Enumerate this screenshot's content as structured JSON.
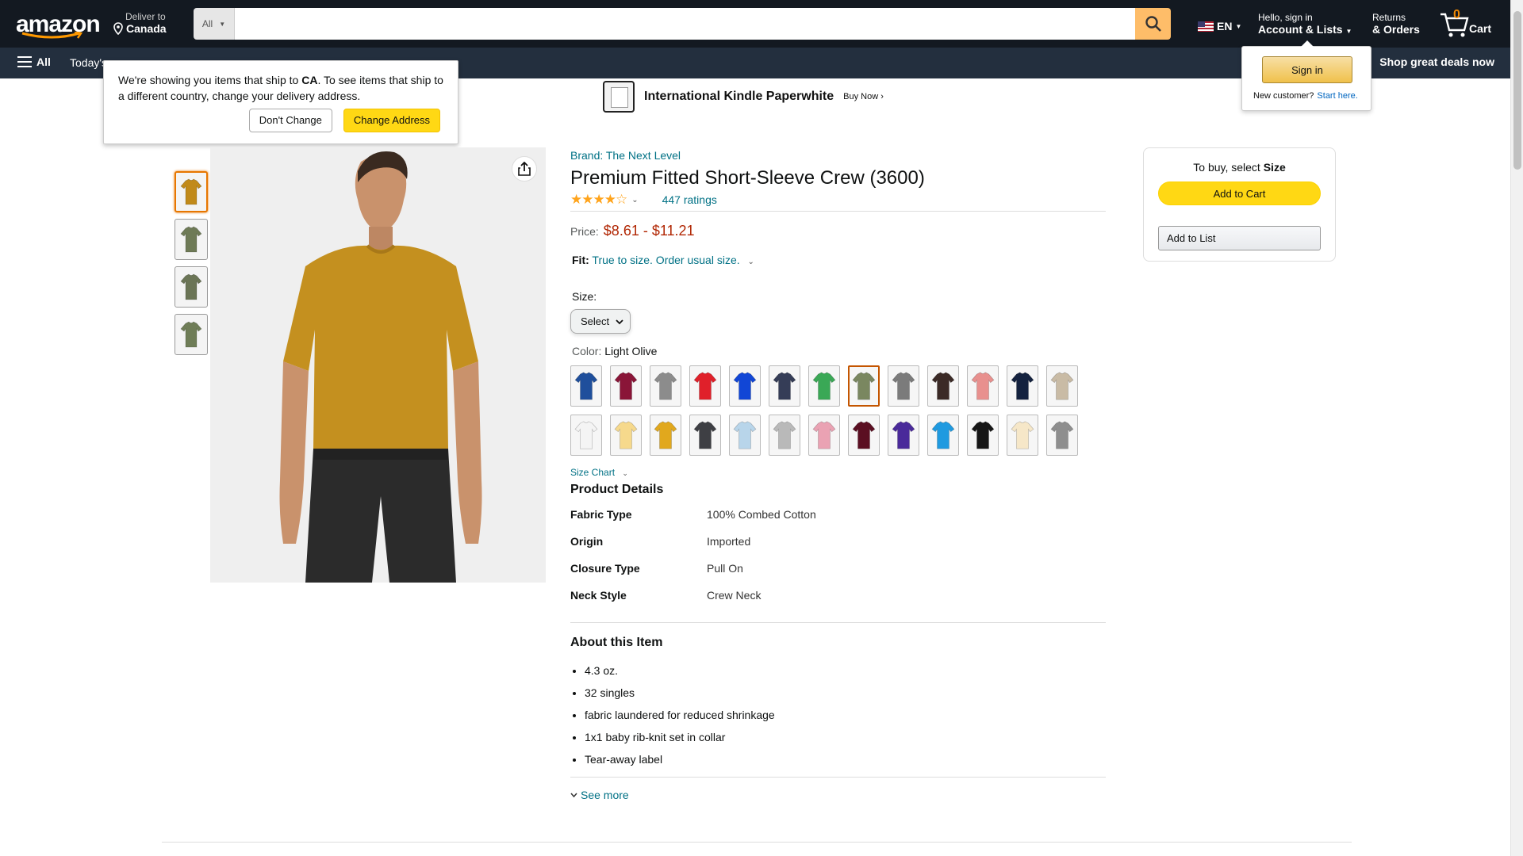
{
  "header": {
    "logo_text": "amazon",
    "deliver_line1": "Deliver to",
    "deliver_line2": "Canada",
    "search_category": "All",
    "search_placeholder": "",
    "lang": "EN",
    "account_line1": "Hello, sign in",
    "account_line2": "Account & Lists",
    "returns_line1": "Returns",
    "returns_line2": "& Orders",
    "cart_count": "0",
    "cart_label": "Cart"
  },
  "subnav": {
    "all_label": "All",
    "todays": "Today's",
    "deals": "Shop great deals now"
  },
  "banner": {
    "title": "International Kindle Paperwhite",
    "cta": "Buy Now ›"
  },
  "ship_popover": {
    "text_before": "We're showing you items that ship to ",
    "country": "CA",
    "text_after": ". To see items that ship to a different country, change your delivery address.",
    "dont_change": "Don't Change",
    "change_address": "Change Address"
  },
  "signin_popover": {
    "signin": "Sign in",
    "new_customer": "New customer?",
    "start_here": "Start here."
  },
  "product": {
    "brand": "Brand: The Next Level",
    "title": "Premium Fitted Short-Sleeve Crew (3600)",
    "stars": "★★★★☆",
    "ratings": "447 ratings",
    "price_label": "Price:",
    "price_range": "$8.61 - $11.21",
    "fit_label": "Fit:",
    "fit_value": "True to size. Order usual size.",
    "size_label": "Size:",
    "size_select": "Select",
    "color_label": "Color:",
    "color_value": "Light Olive",
    "size_chart": "Size Chart",
    "details_title": "Product Details",
    "details": [
      {
        "key": "Fabric Type",
        "value": "100% Combed Cotton"
      },
      {
        "key": "Origin",
        "value": "Imported"
      },
      {
        "key": "Closure Type",
        "value": "Pull On"
      },
      {
        "key": "Neck Style",
        "value": "Crew Neck"
      }
    ],
    "about_title": "About this Item",
    "about": [
      "4.3 oz.",
      "32 singles",
      "fabric laundered for reduced shrinkage",
      "1x1 baby rib-knit set in collar",
      "Tear-away label"
    ],
    "see_more": "See more"
  },
  "swatch_colors": [
    "#1f4f9c",
    "#8a1538",
    "#8c8c8c",
    "#e0202a",
    "#1146d6",
    "#353d57",
    "#3aa856",
    "#7a8760",
    "#7b7b7b",
    "#3b2a26",
    "#e8908e",
    "#14223f",
    "#c9bba5",
    "#f4f4f4",
    "#f6d98c",
    "#e1a81d",
    "#3e3f44",
    "#b8d5ea",
    "#b9b9b9",
    "#eaa2b3",
    "#5b0f22",
    "#4a2a9a",
    "#1f9ae0",
    "#161616",
    "#f6e7c8",
    "#8e8e8e"
  ],
  "thumb_colors": [
    "#c18a1a",
    "#6e7a56",
    "#6b7556",
    "#6f7d57"
  ],
  "buybox": {
    "need_prefix": "To buy, select ",
    "need_bold": "Size",
    "add_to_cart": "Add to Cart",
    "add_to_list": "Add to List"
  }
}
